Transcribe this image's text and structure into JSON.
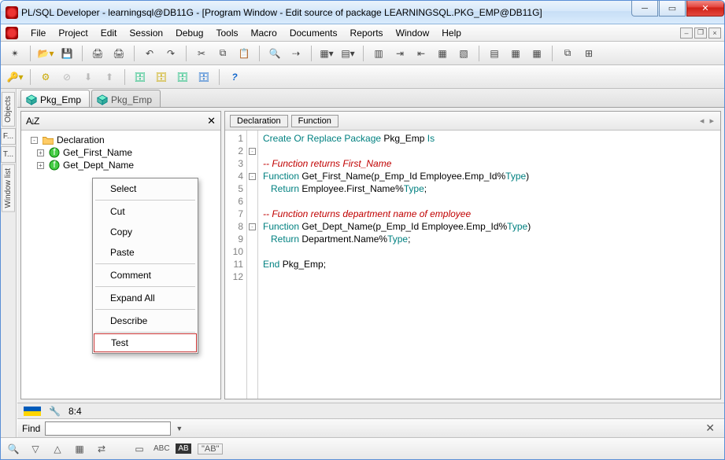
{
  "title": "PL/SQL Developer - learningsql@DB11G - [Program Window - Edit source of package LEARNINGSQL.PKG_EMP@DB11G]",
  "menu": [
    "File",
    "Project",
    "Edit",
    "Session",
    "Debug",
    "Tools",
    "Macro",
    "Documents",
    "Reports",
    "Window",
    "Help"
  ],
  "vtabs": [
    "Objects",
    "F...",
    "T...",
    "Window list"
  ],
  "doc_tabs": [
    {
      "label": "Pkg_Emp",
      "active": true
    },
    {
      "label": "Pkg_Emp",
      "active": false
    }
  ],
  "tree": {
    "root": "Declaration",
    "items": [
      "Get_First_Name",
      "Get_Dept_Name"
    ]
  },
  "context_menu": [
    "Select",
    "Cut",
    "Copy",
    "Paste",
    "Comment",
    "Expand All",
    "Describe",
    "Test"
  ],
  "context_highlight": "Test",
  "mini_tabs": [
    "Declaration",
    "Function"
  ],
  "code_lines": [
    {
      "n": 1,
      "f": "",
      "html": "<span class='kw'>Create Or Replace Package</span> Pkg_Emp <span class='kw'>Is</span>"
    },
    {
      "n": 2,
      "f": "-",
      "html": ""
    },
    {
      "n": 3,
      "f": "",
      "html": "<span class='cm'>-- Function returns First_Name</span>"
    },
    {
      "n": 4,
      "f": "-",
      "html": "<span class='kw'>Function</span> Get_First_Name(p_Emp_Id Employee.Emp_Id%<span class='kw'>Type</span>)"
    },
    {
      "n": 5,
      "f": "",
      "html": "   <span class='kw'>Return</span> Employee.First_Name%<span class='kw'>Type</span>;"
    },
    {
      "n": 6,
      "f": "",
      "html": ""
    },
    {
      "n": 7,
      "f": "",
      "html": "<span class='cm'>-- Function returns department name of employee</span>"
    },
    {
      "n": 8,
      "f": "-",
      "html": "<span class='kw'>Function</span> Get_Dept_Name(p_Emp_Id Employee.Emp_Id%<span class='kw'>Type</span>)"
    },
    {
      "n": 9,
      "f": "",
      "html": "   <span class='kw'>Return</span> Department.Name%<span class='kw'>Type</span>;"
    },
    {
      "n": 10,
      "f": "",
      "html": ""
    },
    {
      "n": 11,
      "f": "",
      "html": "<span class='kw'>End</span> Pkg_Emp;"
    },
    {
      "n": 12,
      "f": "",
      "html": ""
    }
  ],
  "status": {
    "pos": "8:4"
  },
  "find": {
    "label": "Find",
    "value": "",
    "quoted": "\"AB\""
  }
}
